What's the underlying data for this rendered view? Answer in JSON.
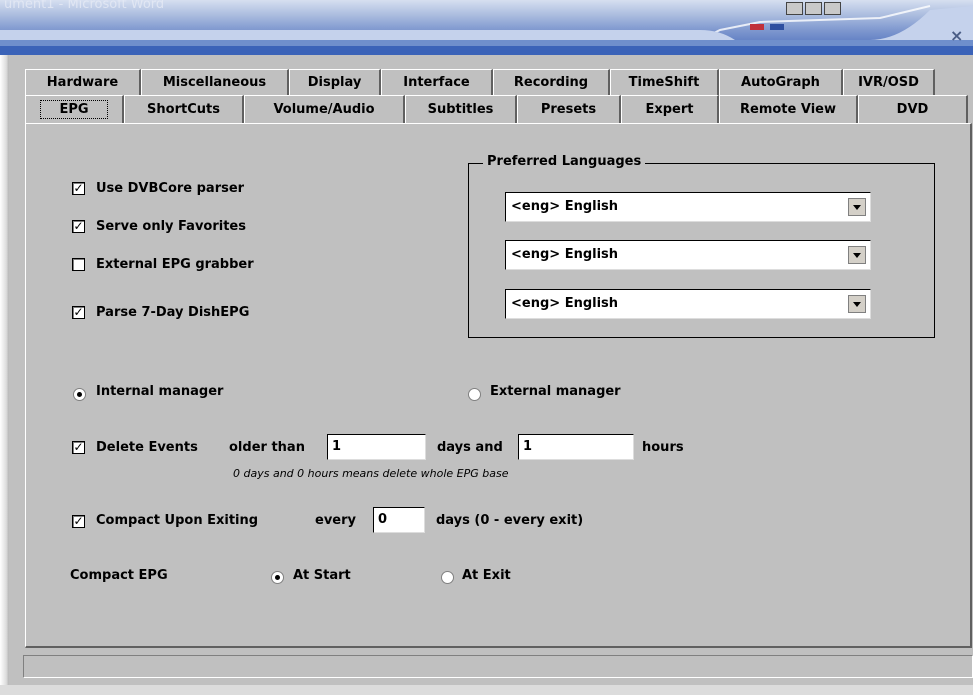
{
  "window": {
    "title": "ument1 - Microsoft Word"
  },
  "tabs_row1": [
    {
      "label": "Hardware"
    },
    {
      "label": "Miscellaneous"
    },
    {
      "label": "Display"
    },
    {
      "label": "Interface"
    },
    {
      "label": "Recording"
    },
    {
      "label": "TimeShift"
    },
    {
      "label": "AutoGraph"
    },
    {
      "label": "IVR/OSD"
    }
  ],
  "tabs_row2": [
    {
      "label": "EPG",
      "selected": true
    },
    {
      "label": "ShortCuts"
    },
    {
      "label": "Volume/Audio"
    },
    {
      "label": "Subtitles"
    },
    {
      "label": "Presets"
    },
    {
      "label": "Expert"
    },
    {
      "label": "Remote View"
    },
    {
      "label": "DVD"
    }
  ],
  "options": {
    "use_dvbcore": {
      "label": "Use DVBCore parser",
      "checked": true
    },
    "serve_favorites": {
      "label": "Serve only Favorites",
      "checked": true
    },
    "external_grabber": {
      "label": "External EPG grabber",
      "checked": false
    },
    "parse_dish": {
      "label": "Parse 7-Day DishEPG",
      "checked": true
    }
  },
  "preferred_languages": {
    "legend": "Preferred Languages",
    "values": [
      "<eng> English",
      "<eng> English",
      "<eng> English"
    ]
  },
  "manager": {
    "internal": {
      "label": "Internal manager",
      "selected": true
    },
    "external": {
      "label": "External manager",
      "selected": false
    }
  },
  "delete_events": {
    "label": "Delete Events",
    "checked": true,
    "older_than_label": "older than",
    "days_value": "1",
    "days_and_label": "days and",
    "hours_value": "1",
    "hours_label": "hours",
    "hint": "0 days and 0 hours means delete whole EPG base"
  },
  "compact": {
    "label": "Compact Upon Exiting",
    "checked": true,
    "every_label": "every",
    "days_value": "0",
    "days_suffix": "days (0 - every exit)"
  },
  "compact_epg": {
    "label": "Compact EPG",
    "at_start": {
      "label": "At Start",
      "selected": true
    },
    "at_exit": {
      "label": "At Exit",
      "selected": false
    }
  },
  "close_glyph": "×"
}
